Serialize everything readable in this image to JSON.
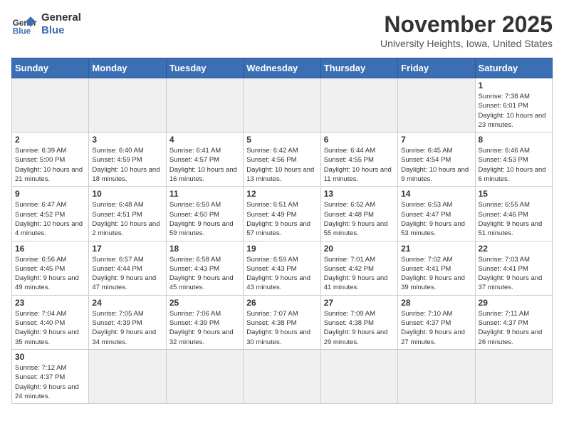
{
  "header": {
    "logo_general": "General",
    "logo_blue": "Blue",
    "month_year": "November 2025",
    "location": "University Heights, Iowa, United States"
  },
  "weekdays": [
    "Sunday",
    "Monday",
    "Tuesday",
    "Wednesday",
    "Thursday",
    "Friday",
    "Saturday"
  ],
  "weeks": [
    [
      {
        "day": "",
        "info": ""
      },
      {
        "day": "",
        "info": ""
      },
      {
        "day": "",
        "info": ""
      },
      {
        "day": "",
        "info": ""
      },
      {
        "day": "",
        "info": ""
      },
      {
        "day": "",
        "info": ""
      },
      {
        "day": "1",
        "info": "Sunrise: 7:38 AM\nSunset: 6:01 PM\nDaylight: 10 hours and 23 minutes."
      }
    ],
    [
      {
        "day": "2",
        "info": "Sunrise: 6:39 AM\nSunset: 5:00 PM\nDaylight: 10 hours and 21 minutes."
      },
      {
        "day": "3",
        "info": "Sunrise: 6:40 AM\nSunset: 4:59 PM\nDaylight: 10 hours and 18 minutes."
      },
      {
        "day": "4",
        "info": "Sunrise: 6:41 AM\nSunset: 4:57 PM\nDaylight: 10 hours and 16 minutes."
      },
      {
        "day": "5",
        "info": "Sunrise: 6:42 AM\nSunset: 4:56 PM\nDaylight: 10 hours and 13 minutes."
      },
      {
        "day": "6",
        "info": "Sunrise: 6:44 AM\nSunset: 4:55 PM\nDaylight: 10 hours and 11 minutes."
      },
      {
        "day": "7",
        "info": "Sunrise: 6:45 AM\nSunset: 4:54 PM\nDaylight: 10 hours and 9 minutes."
      },
      {
        "day": "8",
        "info": "Sunrise: 6:46 AM\nSunset: 4:53 PM\nDaylight: 10 hours and 6 minutes."
      }
    ],
    [
      {
        "day": "9",
        "info": "Sunrise: 6:47 AM\nSunset: 4:52 PM\nDaylight: 10 hours and 4 minutes."
      },
      {
        "day": "10",
        "info": "Sunrise: 6:48 AM\nSunset: 4:51 PM\nDaylight: 10 hours and 2 minutes."
      },
      {
        "day": "11",
        "info": "Sunrise: 6:50 AM\nSunset: 4:50 PM\nDaylight: 9 hours and 59 minutes."
      },
      {
        "day": "12",
        "info": "Sunrise: 6:51 AM\nSunset: 4:49 PM\nDaylight: 9 hours and 57 minutes."
      },
      {
        "day": "13",
        "info": "Sunrise: 6:52 AM\nSunset: 4:48 PM\nDaylight: 9 hours and 55 minutes."
      },
      {
        "day": "14",
        "info": "Sunrise: 6:53 AM\nSunset: 4:47 PM\nDaylight: 9 hours and 53 minutes."
      },
      {
        "day": "15",
        "info": "Sunrise: 6:55 AM\nSunset: 4:46 PM\nDaylight: 9 hours and 51 minutes."
      }
    ],
    [
      {
        "day": "16",
        "info": "Sunrise: 6:56 AM\nSunset: 4:45 PM\nDaylight: 9 hours and 49 minutes."
      },
      {
        "day": "17",
        "info": "Sunrise: 6:57 AM\nSunset: 4:44 PM\nDaylight: 9 hours and 47 minutes."
      },
      {
        "day": "18",
        "info": "Sunrise: 6:58 AM\nSunset: 4:43 PM\nDaylight: 9 hours and 45 minutes."
      },
      {
        "day": "19",
        "info": "Sunrise: 6:59 AM\nSunset: 4:43 PM\nDaylight: 9 hours and 43 minutes."
      },
      {
        "day": "20",
        "info": "Sunrise: 7:01 AM\nSunset: 4:42 PM\nDaylight: 9 hours and 41 minutes."
      },
      {
        "day": "21",
        "info": "Sunrise: 7:02 AM\nSunset: 4:41 PM\nDaylight: 9 hours and 39 minutes."
      },
      {
        "day": "22",
        "info": "Sunrise: 7:03 AM\nSunset: 4:41 PM\nDaylight: 9 hours and 37 minutes."
      }
    ],
    [
      {
        "day": "23",
        "info": "Sunrise: 7:04 AM\nSunset: 4:40 PM\nDaylight: 9 hours and 35 minutes."
      },
      {
        "day": "24",
        "info": "Sunrise: 7:05 AM\nSunset: 4:39 PM\nDaylight: 9 hours and 34 minutes."
      },
      {
        "day": "25",
        "info": "Sunrise: 7:06 AM\nSunset: 4:39 PM\nDaylight: 9 hours and 32 minutes."
      },
      {
        "day": "26",
        "info": "Sunrise: 7:07 AM\nSunset: 4:38 PM\nDaylight: 9 hours and 30 minutes."
      },
      {
        "day": "27",
        "info": "Sunrise: 7:09 AM\nSunset: 4:38 PM\nDaylight: 9 hours and 29 minutes."
      },
      {
        "day": "28",
        "info": "Sunrise: 7:10 AM\nSunset: 4:37 PM\nDaylight: 9 hours and 27 minutes."
      },
      {
        "day": "29",
        "info": "Sunrise: 7:11 AM\nSunset: 4:37 PM\nDaylight: 9 hours and 26 minutes."
      }
    ],
    [
      {
        "day": "30",
        "info": "Sunrise: 7:12 AM\nSunset: 4:37 PM\nDaylight: 9 hours and 24 minutes."
      },
      {
        "day": "",
        "info": ""
      },
      {
        "day": "",
        "info": ""
      },
      {
        "day": "",
        "info": ""
      },
      {
        "day": "",
        "info": ""
      },
      {
        "day": "",
        "info": ""
      },
      {
        "day": "",
        "info": ""
      }
    ]
  ]
}
